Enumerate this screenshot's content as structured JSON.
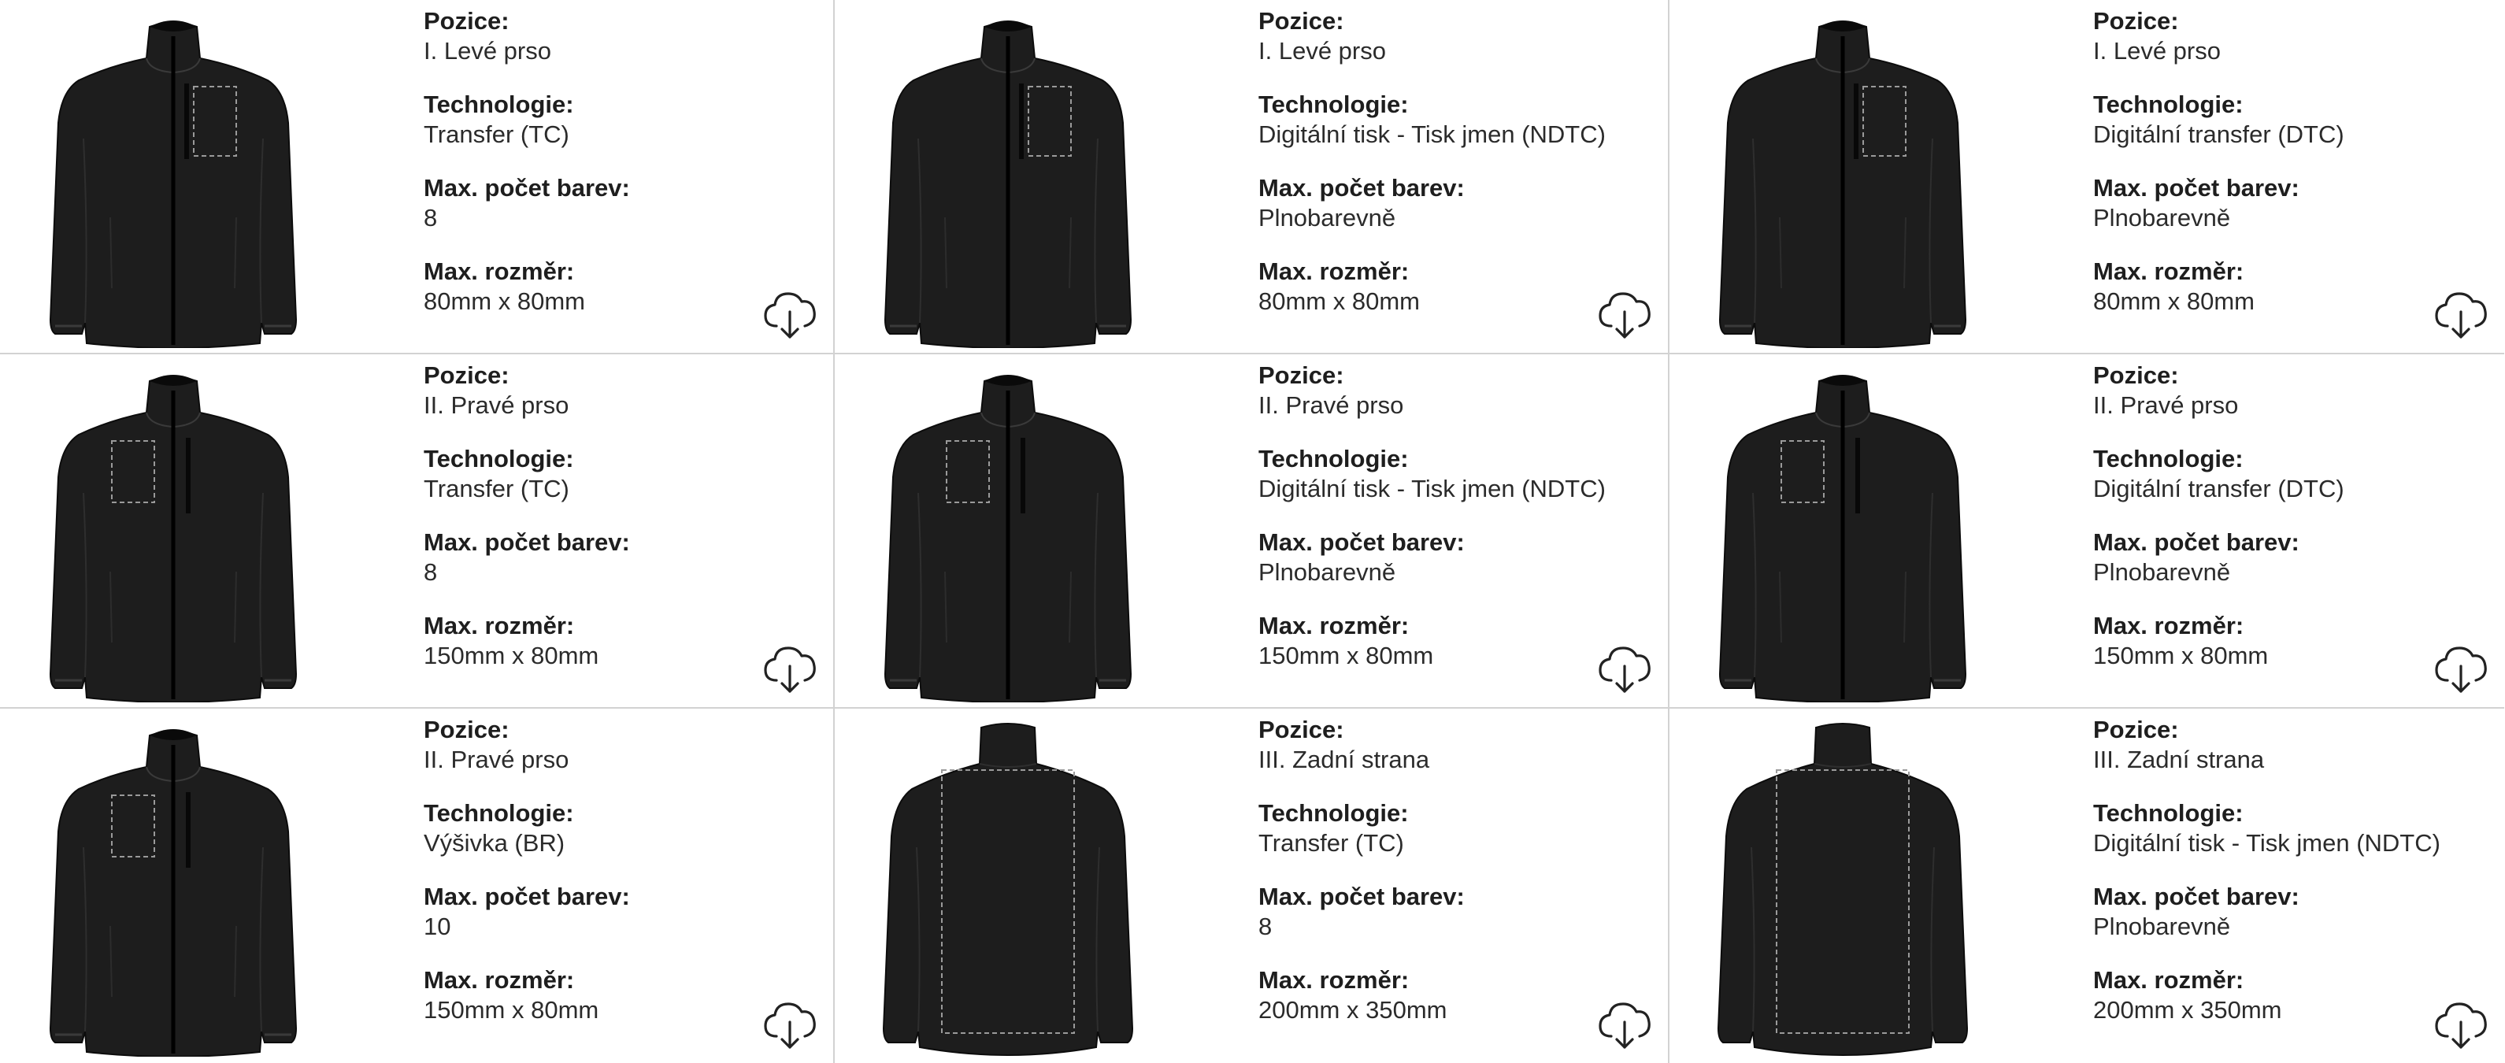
{
  "labels": {
    "position": "Pozice:",
    "technology": "Technologie:",
    "colors": "Max. počet barev:",
    "size": "Max. rozměr:"
  },
  "download_icon": "cloud-download-icon",
  "jacket_color": "#1d1d1d",
  "print_area_outline": "#9a9a9a",
  "items": [
    {
      "position": "I. Levé prso",
      "technology": "Transfer (TC)",
      "colors": "8",
      "size": "80mm x 80mm",
      "view": "front",
      "area": "left-chest"
    },
    {
      "position": "I. Levé prso",
      "technology": "Digitální tisk - Tisk jmen (NDTC)",
      "colors": "Plnobarevně",
      "size": "80mm x 80mm",
      "view": "front",
      "area": "left-chest"
    },
    {
      "position": "I. Levé prso",
      "technology": "Digitální transfer (DTC)",
      "colors": "Plnobarevně",
      "size": "80mm x 80mm",
      "view": "front",
      "area": "left-chest"
    },
    {
      "position": "II. Pravé prso",
      "technology": "Transfer (TC)",
      "colors": "8",
      "size": "150mm x 80mm",
      "view": "front",
      "area": "right-chest"
    },
    {
      "position": "II. Pravé prso",
      "technology": "Digitální tisk - Tisk jmen (NDTC)",
      "colors": "Plnobarevně",
      "size": "150mm x 80mm",
      "view": "front",
      "area": "right-chest"
    },
    {
      "position": "II. Pravé prso",
      "technology": "Digitální transfer (DTC)",
      "colors": "Plnobarevně",
      "size": "150mm x 80mm",
      "view": "front",
      "area": "right-chest"
    },
    {
      "position": "II. Pravé prso",
      "technology": "Výšivka (BR)",
      "colors": "10",
      "size": "150mm x 80mm",
      "view": "front",
      "area": "right-chest"
    },
    {
      "position": "III. Zadní strana",
      "technology": "Transfer (TC)",
      "colors": "8",
      "size": "200mm x 350mm",
      "view": "back",
      "area": "back"
    },
    {
      "position": "III. Zadní strana",
      "technology": "Digitální tisk - Tisk jmen (NDTC)",
      "colors": "Plnobarevně",
      "size": "200mm x 350mm",
      "view": "back",
      "area": "back"
    }
  ]
}
